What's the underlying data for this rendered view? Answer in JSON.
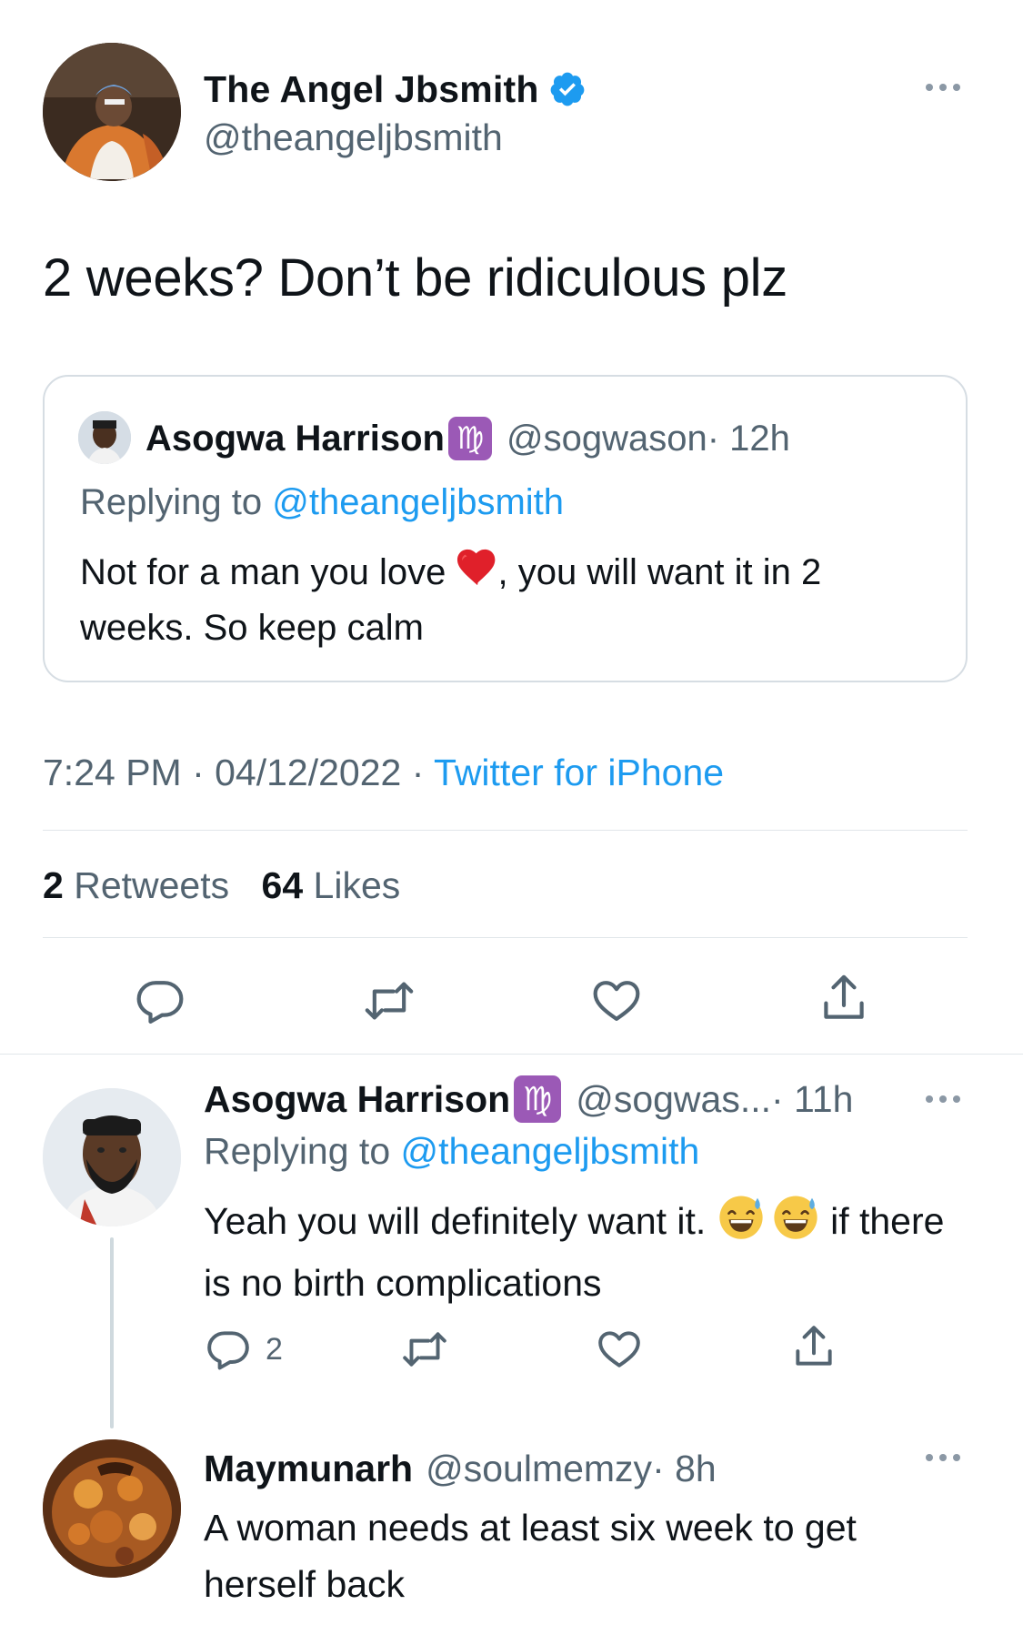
{
  "main_tweet": {
    "author_name": "The Angel Jbsmith",
    "author_handle": "@theangeljbsmith",
    "text": "2 weeks? Don’t be ridiculous plz",
    "timestamp": "7:24 PM · 04/12/2022 · ",
    "source": "Twitter for iPhone",
    "retweets_count": "2",
    "retweets_label": " Retweets",
    "likes_count": "64",
    "likes_label": " Likes"
  },
  "quoted_tweet": {
    "author_name": "Asogwa Harrison",
    "zodiac": "♍",
    "author_handle": "@sogwason",
    "time": " · 12h",
    "replying_prefix": "Replying to ",
    "replying_to": "@theangeljbsmith",
    "text_part1": "Not for a man you love ",
    "text_part2": ", you will want it in 2 weeks. So keep calm"
  },
  "replies": [
    {
      "author_name": "Asogwa Harrison",
      "zodiac": "♍",
      "author_handle": "@sogwas...",
      "time": " · 11h",
      "replying_prefix": "Replying to ",
      "replying_to": "@theangeljbsmith",
      "text_part1": "Yeah you will definitely want it. ",
      "text_part2": " if there is no birth complications",
      "reply_count": "2"
    },
    {
      "author_name": "Maymunarh",
      "author_handle": "@soulmemzy",
      "time": " · 8h",
      "text": "A woman needs at least six week to get herself back"
    }
  ],
  "icons": {
    "verified": "verified-badge-icon",
    "more": "more-options-icon",
    "reply": "reply-icon",
    "retweet": "retweet-icon",
    "like": "heart-icon",
    "share": "share-icon"
  },
  "colors": {
    "accent": "#1d9bf0",
    "muted_text": "#536471",
    "divider": "#e1e6ea",
    "icon_gray": "#657786"
  }
}
